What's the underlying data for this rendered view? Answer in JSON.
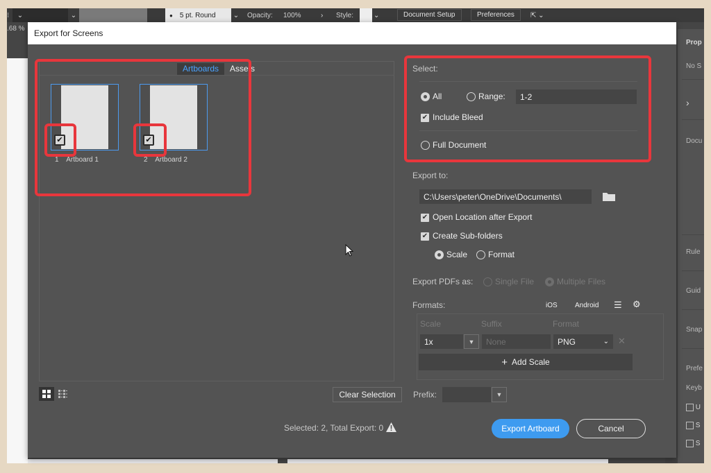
{
  "app": {
    "control_bar": {
      "stroke_label": "5 pt. Round",
      "opacity_label": "Opacity:",
      "opacity_value": "100%",
      "style_label": "Style:",
      "document_setup": "Document Setup",
      "preferences": "Preferences"
    },
    "zoom_level": ".68 %",
    "properties_panel": {
      "items": [
        "Prop",
        "No S",
        "Docu",
        "Rule",
        "Guid",
        "Snap",
        "Prefe",
        "Keyb"
      ],
      "checkbox_items": [
        "U",
        "S",
        "S"
      ]
    }
  },
  "dialog": {
    "title": "Export for Screens",
    "tabs": [
      {
        "label": "Artboards",
        "active": true
      },
      {
        "label": "Assets",
        "active": false
      }
    ],
    "artboards": [
      {
        "number": "1",
        "name": "Artboard 1",
        "checked": true
      },
      {
        "number": "2",
        "name": "Artboard 2",
        "checked": true
      }
    ],
    "view_buttons": [
      "grid-view",
      "list-view"
    ],
    "clear_selection": "Clear Selection",
    "select": {
      "label": "Select:",
      "all": "All",
      "range": "Range:",
      "range_value": "1-2",
      "selected_option": "All",
      "include_bleed": "Include Bleed",
      "include_bleed_checked": true,
      "full_document": "Full Document"
    },
    "export_to": {
      "label": "Export to:",
      "path": "C:\\Users\\peter\\OneDrive\\Documents\\",
      "open_location": "Open Location after Export",
      "open_location_checked": true,
      "create_subfolders": "Create Sub-folders",
      "create_subfolders_checked": true,
      "scale": "Scale",
      "format": "Format",
      "subfolder_by": "Scale"
    },
    "export_pdfs": {
      "label": "Export PDFs as:",
      "single": "Single File",
      "multiple": "Multiple Files",
      "selected": "Multiple Files"
    },
    "formats": {
      "label": "Formats:",
      "ios": "iOS",
      "android": "Android",
      "columns": [
        "Scale",
        "Suffix",
        "Format"
      ],
      "rows": [
        {
          "scale": "1x",
          "suffix_placeholder": "None",
          "format": "PNG"
        }
      ],
      "add_scale": "Add Scale"
    },
    "prefix": {
      "label": "Prefix:",
      "value": ""
    },
    "status": "Selected: 2, Total Export: 0",
    "export_button": "Export Artboard",
    "cancel_button": "Cancel"
  },
  "colors": {
    "accent": "#3e9bf0",
    "highlight": "#e8363c",
    "dialog_bg": "#535353"
  }
}
